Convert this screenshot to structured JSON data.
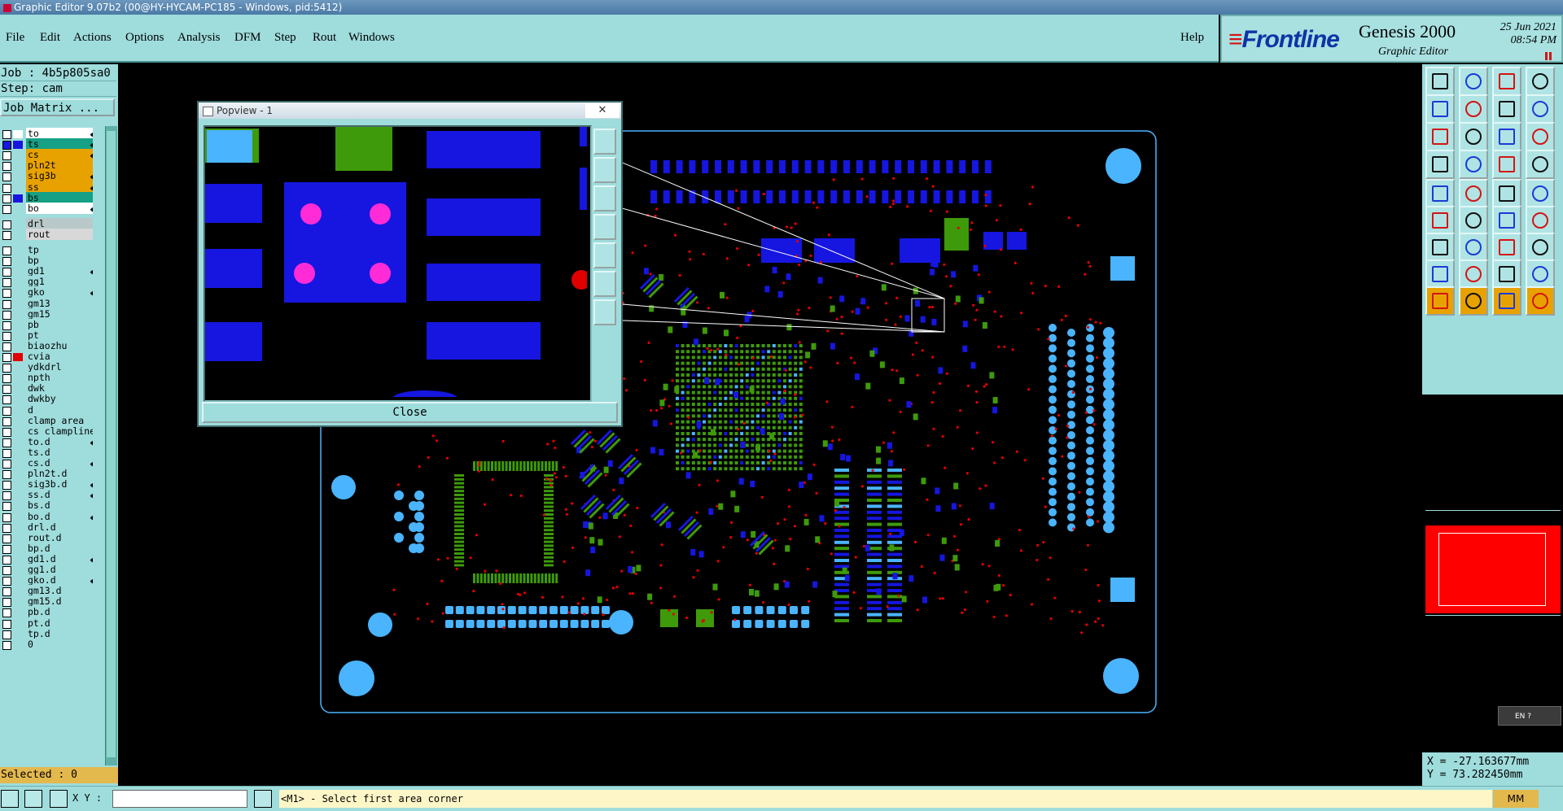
{
  "window": {
    "title": "Graphic Editor 9.07b2 (00@HY-HYCAM-PC185 - Windows, pid:5412)"
  },
  "menu": {
    "items": [
      "File",
      "Edit",
      "Actions",
      "Options",
      "Analysis",
      "DFM",
      "Step",
      "Rout",
      "Windows"
    ],
    "help": "Help"
  },
  "brand": {
    "logo": "Frontline",
    "product": "Genesis 2000",
    "subtitle": "Graphic Editor",
    "date": "25 Jun 2021",
    "time": "08:54 PM"
  },
  "job": {
    "job_line": "Job : 4b5p805sa0",
    "step_line": "Step: cam",
    "matrix_button": "Job Matrix ..."
  },
  "layers": [
    {
      "name": "to",
      "color": "#ffffff",
      "bg": "#ffffff",
      "mark": "◆",
      "check": "white"
    },
    {
      "name": "ts",
      "color": "#1616e0",
      "bg": "#16a085",
      "mark": "◆",
      "check": "blue"
    },
    {
      "name": "cs",
      "color": "",
      "bg": "#e8a200",
      "mark": "◆",
      "check": "white"
    },
    {
      "name": "pln2t",
      "color": "",
      "bg": "#e8a200",
      "mark": "",
      "check": "white"
    },
    {
      "name": "sig3b",
      "color": "",
      "bg": "#e8a200",
      "mark": "◆",
      "check": "white"
    },
    {
      "name": "ss",
      "color": "",
      "bg": "#e8a200",
      "mark": "◆",
      "check": "white"
    },
    {
      "name": "bs",
      "color": "#1616e0",
      "bg": "#16a085",
      "mark": "",
      "check": "white"
    },
    {
      "name": "bo",
      "color": "",
      "bg": "#ffffff",
      "mark": "◆",
      "check": "white"
    },
    {
      "name": "drl",
      "color": "",
      "bg": "#b9c9c9",
      "mark": "",
      "check": "white"
    },
    {
      "name": "rout",
      "color": "",
      "bg": "#d8d8d8",
      "mark": "",
      "check": "white"
    },
    {
      "name": "tp",
      "color": "",
      "bg": "#9fdcdc",
      "mark": "",
      "check": "white"
    },
    {
      "name": "bp",
      "color": "",
      "bg": "#9fdcdc",
      "mark": "",
      "check": "white"
    },
    {
      "name": "gd1",
      "color": "",
      "bg": "#9fdcdc",
      "mark": "◆",
      "check": "white"
    },
    {
      "name": "gg1",
      "color": "",
      "bg": "#9fdcdc",
      "mark": "",
      "check": "white"
    },
    {
      "name": "gko",
      "color": "",
      "bg": "#9fdcdc",
      "mark": "◆",
      "check": "white"
    },
    {
      "name": "gm13",
      "color": "",
      "bg": "#9fdcdc",
      "mark": "",
      "check": "white"
    },
    {
      "name": "gm15",
      "color": "",
      "bg": "#9fdcdc",
      "mark": "",
      "check": "white"
    },
    {
      "name": "pb",
      "color": "",
      "bg": "#9fdcdc",
      "mark": "",
      "check": "white"
    },
    {
      "name": "pt",
      "color": "",
      "bg": "#9fdcdc",
      "mark": "",
      "check": "white"
    },
    {
      "name": "biaozhu",
      "color": "",
      "bg": "#9fdcdc",
      "mark": "",
      "check": "white"
    },
    {
      "name": "cvia",
      "color": "#e00000",
      "bg": "#9fdcdc",
      "mark": "",
      "check": "white"
    },
    {
      "name": "ydkdrl",
      "color": "",
      "bg": "#9fdcdc",
      "mark": "",
      "check": "white"
    },
    {
      "name": "npth",
      "color": "",
      "bg": "#9fdcdc",
      "mark": "",
      "check": "white"
    },
    {
      "name": "dwk",
      "color": "",
      "bg": "#9fdcdc",
      "mark": "",
      "check": "white"
    },
    {
      "name": "dwkby",
      "color": "",
      "bg": "#9fdcdc",
      "mark": "",
      "check": "white"
    },
    {
      "name": "d",
      "color": "",
      "bg": "#9fdcdc",
      "mark": "",
      "check": "white"
    },
    {
      "name": "clamp_area",
      "color": "",
      "bg": "#9fdcdc",
      "mark": "",
      "check": "white"
    },
    {
      "name": "cs_clampline",
      "color": "",
      "bg": "#9fdcdc",
      "mark": "",
      "check": "white"
    },
    {
      "name": "to.d",
      "color": "",
      "bg": "#9fdcdc",
      "mark": "◆",
      "check": "white"
    },
    {
      "name": "ts.d",
      "color": "",
      "bg": "#9fdcdc",
      "mark": "",
      "check": "white"
    },
    {
      "name": "cs.d",
      "color": "",
      "bg": "#9fdcdc",
      "mark": "◆",
      "check": "white"
    },
    {
      "name": "pln2t.d",
      "color": "",
      "bg": "#9fdcdc",
      "mark": "",
      "check": "white"
    },
    {
      "name": "sig3b.d",
      "color": "",
      "bg": "#9fdcdc",
      "mark": "◆",
      "check": "white"
    },
    {
      "name": "ss.d",
      "color": "",
      "bg": "#9fdcdc",
      "mark": "◆",
      "check": "white"
    },
    {
      "name": "bs.d",
      "color": "",
      "bg": "#9fdcdc",
      "mark": "",
      "check": "white"
    },
    {
      "name": "bo.d",
      "color": "",
      "bg": "#9fdcdc",
      "mark": "◆",
      "check": "white"
    },
    {
      "name": "drl.d",
      "color": "",
      "bg": "#9fdcdc",
      "mark": "",
      "check": "white"
    },
    {
      "name": "rout.d",
      "color": "",
      "bg": "#9fdcdc",
      "mark": "",
      "check": "white"
    },
    {
      "name": "bp.d",
      "color": "",
      "bg": "#9fdcdc",
      "mark": "",
      "check": "white"
    },
    {
      "name": "gd1.d",
      "color": "",
      "bg": "#9fdcdc",
      "mark": "◆",
      "check": "white"
    },
    {
      "name": "gg1.d",
      "color": "",
      "bg": "#9fdcdc",
      "mark": "",
      "check": "white"
    },
    {
      "name": "gko.d",
      "color": "",
      "bg": "#9fdcdc",
      "mark": "◆",
      "check": "white"
    },
    {
      "name": "gm13.d",
      "color": "",
      "bg": "#9fdcdc",
      "mark": "",
      "check": "white"
    },
    {
      "name": "gm15.d",
      "color": "",
      "bg": "#9fdcdc",
      "mark": "",
      "check": "white"
    },
    {
      "name": "pb.d",
      "color": "",
      "bg": "#9fdcdc",
      "mark": "",
      "check": "white"
    },
    {
      "name": "pt.d",
      "color": "",
      "bg": "#9fdcdc",
      "mark": "",
      "check": "white"
    },
    {
      "name": "tp.d",
      "color": "",
      "bg": "#9fdcdc",
      "mark": "",
      "check": "white"
    },
    {
      "name": "0",
      "color": "",
      "bg": "#9fdcdc",
      "mark": "",
      "check": "white"
    }
  ],
  "selected": "Selected : 0",
  "status": {
    "xy_label": "X Y :",
    "xy_value": "",
    "message": "<M1> - Select first area corner",
    "units": "MM"
  },
  "coords": {
    "x": "X = -27.163677mm",
    "y": "Y = 73.282450mm"
  },
  "language": "EN",
  "popview": {
    "title": "Popview - 1",
    "close_label": "Close",
    "close_x": "✕"
  },
  "colors": {
    "panel": "#9fdcdc",
    "board_outline": "#4ab4ff",
    "pad_cyan": "#4ab4ff",
    "pad_blue": "#1616e0",
    "pad_green": "#3e9a0a",
    "via_red": "#e00000",
    "magenta": "#ff2bd6"
  }
}
